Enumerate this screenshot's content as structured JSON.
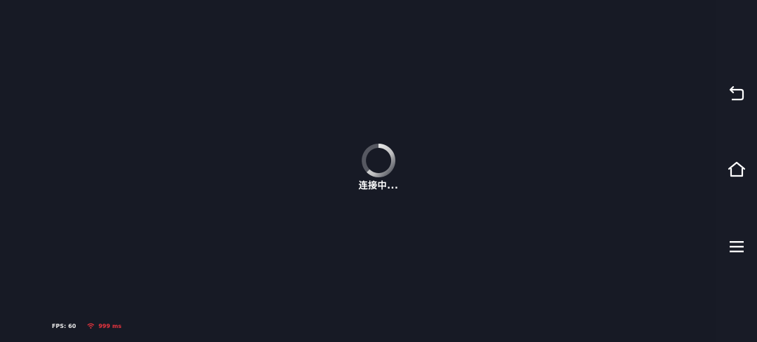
{
  "loader": {
    "status_text": "连接中...",
    "spinner_color": "#e6e6e6"
  },
  "stats": {
    "fps_label": "FPS:",
    "fps_value": "60",
    "ping_value": "999",
    "ping_unit": "ms",
    "ping_icon": "wifi-icon",
    "ping_color": "#e8343e"
  },
  "nav": {
    "buttons": [
      {
        "name": "back-icon"
      },
      {
        "name": "home-icon"
      },
      {
        "name": "menu-icon"
      }
    ]
  },
  "colors": {
    "background": "#171a25",
    "text": "#ffffff"
  }
}
